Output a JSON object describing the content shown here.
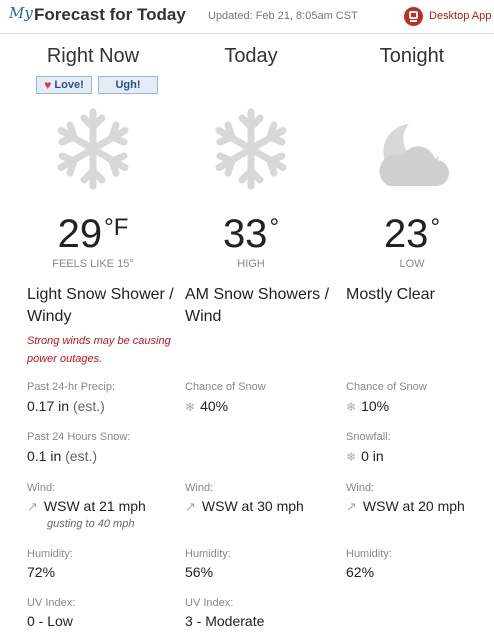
{
  "header": {
    "logo_text": "My",
    "title": "Forecast for Today",
    "updated": "Updated: Feb 21, 8:05am CST",
    "desktop_app": "Desktop App"
  },
  "columns": [
    {
      "title": "Right Now",
      "icon": "snowflake-icon",
      "temp": "29",
      "temp_unit": "°F",
      "temp_sub": "FEELS LIKE 15°",
      "condition": "Light Snow Shower / Windy",
      "warning": "Strong winds may be causing power outages.",
      "rows": [
        {
          "label": "Past 24-hr Precip:",
          "value": "0.17 in",
          "note": "(est.)"
        },
        {
          "label": "Past 24 Hours Snow:",
          "value": "0.1 in",
          "note": "(est.)"
        },
        {
          "label": "Wind:",
          "value": "WSW at 21 mph",
          "sub": "gusting to 40 mph"
        },
        {
          "label": "Humidity:",
          "value": "72%"
        },
        {
          "label": "UV Index:",
          "value": "0 - Low"
        }
      ]
    },
    {
      "title": "Today",
      "icon": "snowflake-icon",
      "temp": "33",
      "temp_unit": "°",
      "temp_sub": "HIGH",
      "condition": "AM Snow Showers / Wind",
      "rows": [
        {
          "label": "Chance of Snow",
          "value": "40%"
        },
        {
          "label": "Wind:",
          "value": "WSW at 30 mph"
        },
        {
          "label": "Humidity:",
          "value": "56%"
        },
        {
          "label": "UV Index:",
          "value": "3 - Moderate"
        }
      ]
    },
    {
      "title": "Tonight",
      "icon": "moon-cloud-icon",
      "temp": "23",
      "temp_unit": "°",
      "temp_sub": "LOW",
      "condition": "Mostly Clear",
      "rows": [
        {
          "label": "Chance of Snow",
          "value": "10%"
        },
        {
          "label": "Snowfall:",
          "value": "0 in"
        },
        {
          "label": "Wind:",
          "value": "WSW at 20 mph"
        },
        {
          "label": "Humidity:",
          "value": "62%"
        }
      ]
    }
  ],
  "feedback": {
    "love": "Love!",
    "ugh": "Ugh!"
  },
  "colors": {
    "accent": "#c42a20",
    "warning": "#c0141b",
    "icon_gray": "#d8d8d8"
  }
}
